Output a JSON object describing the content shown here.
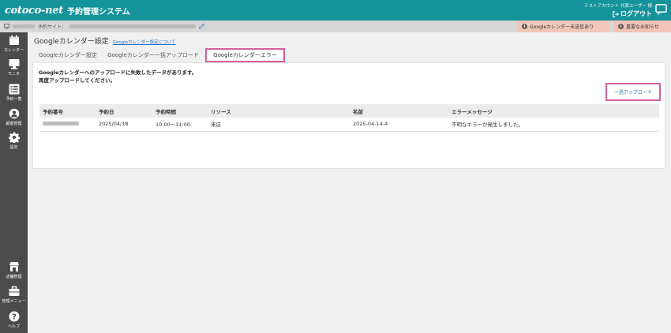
{
  "header": {
    "logo_text": "cotoco-net",
    "system_name": "予約管理システム",
    "account_label": "テストアカウント 代表ユーザー 様",
    "logout_label": "ログアウト"
  },
  "subbar": {
    "site_label": "予約サイト："
  },
  "alerts": {
    "calendar_unsent": "Googleカレンダー未送信あり",
    "notice": "重要なお知らせ"
  },
  "sidebar": {
    "top_items": [
      {
        "label": "カレンダー",
        "icon": "calendar-icon"
      },
      {
        "label": "モニタ",
        "icon": "monitor-icon"
      },
      {
        "label": "予約一覧",
        "icon": "list-icon"
      },
      {
        "label": "顧客管理",
        "icon": "user-icon"
      },
      {
        "label": "設定",
        "icon": "gear-icon"
      }
    ],
    "bottom_items": [
      {
        "label": "店舗管理",
        "icon": "store-icon"
      },
      {
        "label": "管理メニュー",
        "icon": "toolbox-icon"
      },
      {
        "label": "ヘルプ",
        "icon": "help-icon"
      }
    ]
  },
  "page": {
    "title": "Googleカレンダー設定",
    "help_link": "Googleカレンダー設定について"
  },
  "tabs": [
    {
      "label": "Googleカレンダー設定"
    },
    {
      "label": "Googleカレンダー一括アップロード"
    },
    {
      "label": "Googleカレンダーエラー",
      "active": true
    }
  ],
  "content": {
    "message_line1": "Googleカレンダーへのアップロードに失敗したデータがあります。",
    "message_line2": "再度アップロードしてください。",
    "bulk_upload_label": "一括アップロード"
  },
  "table": {
    "headers": [
      "予約番号",
      "予約日",
      "予約時間",
      "リソース",
      "名前",
      "エラーメッセージ"
    ],
    "rows": [
      [
        "",
        "2025/04/18",
        "10:00～11:00",
        "来店",
        "2025-04-14-4",
        "不明なエラーが発生しました。"
      ]
    ]
  },
  "colors": {
    "header_bg": "#15939a",
    "sidebar_bg": "#4b4b4b",
    "highlight": "#d4609a",
    "alert_bg": "#f0c7b8"
  }
}
